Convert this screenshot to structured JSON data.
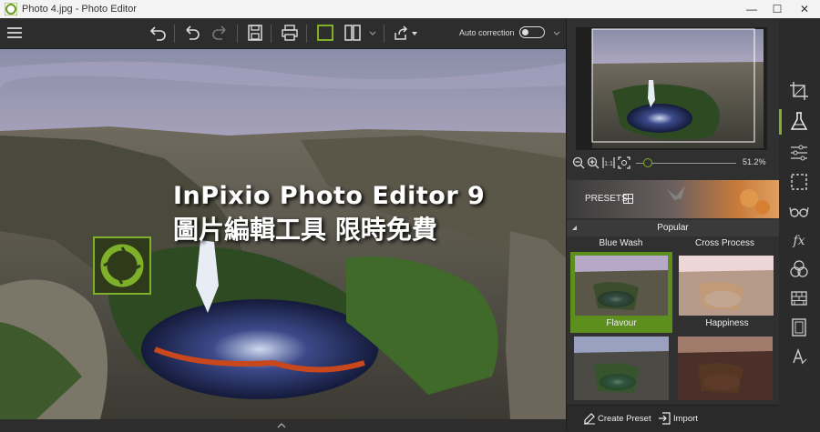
{
  "window": {
    "title": "Photo 4.jpg - Photo Editor",
    "minimize": "—",
    "maximize": "☐",
    "close": "✕"
  },
  "toolbar": {
    "auto_correction_label": "Auto correction",
    "auto_correction_on": false
  },
  "overlay": {
    "line1": "InPixio Photo Editor 9",
    "line2": "圖片編輯工具 限時免費"
  },
  "navigator": {
    "zoom": "51.2%",
    "zoom_level": 0.12
  },
  "presets": {
    "banner_label": "PRESETS",
    "section": "Popular",
    "items": [
      {
        "name": "Blue Wash",
        "partial": true
      },
      {
        "name": "Cross Process",
        "partial": true
      },
      {
        "name": "Flavour",
        "selected": true
      },
      {
        "name": "Happiness"
      },
      {
        "name": ""
      },
      {
        "name": ""
      }
    ],
    "create_label": "Create Preset",
    "import_label": "Import"
  },
  "sidebar": {
    "tools": [
      "crop-icon",
      "flask-icon",
      "adjust-sliders-icon",
      "selection-icon",
      "glasses-icon",
      "fx-icon",
      "color-circles-icon",
      "texture-icon",
      "frame-icon",
      "text-icon"
    ]
  },
  "colors": {
    "accent": "#7fb02a",
    "panel": "#303030",
    "toolbar": "#2d2d2d"
  }
}
